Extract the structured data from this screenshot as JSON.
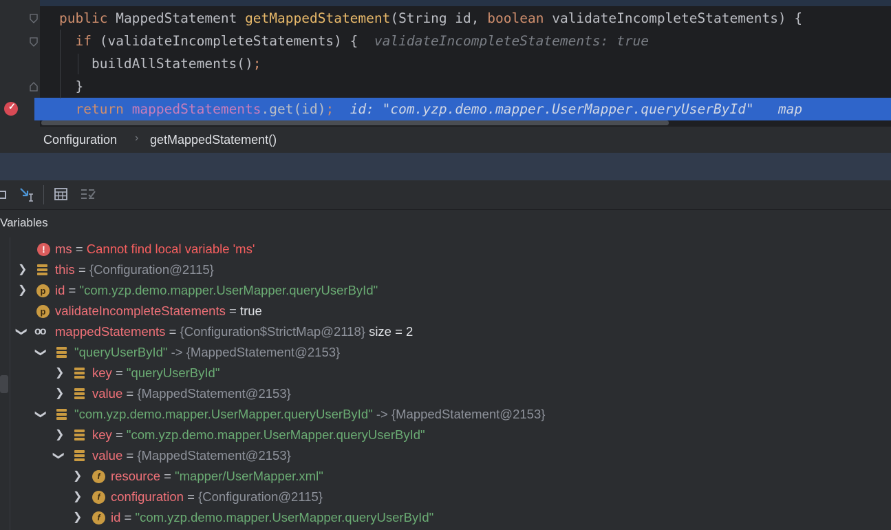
{
  "code": {
    "line1": {
      "kw1": "public",
      "type": "MappedStatement",
      "fn": "getMappedStatement",
      "p1": "(String id, ",
      "kw2": "boolean",
      "p2": " validateIncompleteStatements) {"
    },
    "line2": {
      "kw": "if",
      "rest": " (validateIncompleteStatements) {",
      "hint": "validateIncompleteStatements: true"
    },
    "line3": {
      "call": "buildAllStatements()",
      "semi": ";"
    },
    "line4": {
      "brace": "}"
    },
    "line5": {
      "kw": "return",
      "field": "mappedStatements",
      "call": ".get(id)",
      "semi": ";",
      "hint": "id: \"com.yzp.demo.mapper.UserMapper.queryUserById\"",
      "hint2": "map"
    }
  },
  "breadcrumb": {
    "items": [
      "Configuration",
      "getMappedStatement()"
    ]
  },
  "panel": {
    "title": "Variables"
  },
  "variables": [
    {
      "name": "ms",
      "eq": "=",
      "value": "Cannot find local variable 'ms'",
      "kind": "error"
    },
    {
      "name": "this",
      "eq": "=",
      "value": "{Configuration@2115}"
    },
    {
      "name": "id",
      "eq": "=",
      "value": "\"com.yzp.demo.mapper.UserMapper.queryUserById\""
    },
    {
      "name": "validateIncompleteStatements",
      "eq": "=",
      "value": "true"
    },
    {
      "name": "mappedStatements",
      "eq": "=",
      "value": "{Configuration$StrictMap@2118}",
      "extra": "size = 2"
    },
    {
      "name": "\"queryUserById\"",
      "arrow": "->",
      "value": "{MappedStatement@2153}"
    },
    {
      "name": "key",
      "eq": "=",
      "value": "\"queryUserById\""
    },
    {
      "name": "value",
      "eq": "=",
      "value": "{MappedStatement@2153}"
    },
    {
      "name": "\"com.yzp.demo.mapper.UserMapper.queryUserById\"",
      "arrow": "->",
      "value": "{MappedStatement@2153}"
    },
    {
      "name": "key",
      "eq": "=",
      "value": "\"com.yzp.demo.mapper.UserMapper.queryUserById\""
    },
    {
      "name": "value",
      "eq": "=",
      "value": "{MappedStatement@2153}"
    },
    {
      "name": "resource",
      "eq": "=",
      "value": "\"mapper/UserMapper.xml\""
    },
    {
      "name": "configuration",
      "eq": "=",
      "value": "{Configuration@2115}"
    },
    {
      "name": "id",
      "eq": "=",
      "value": "\"com.yzp.demo.mapper.UserMapper.queryUserById\""
    }
  ],
  "icons": {
    "expand": "chevron-right-icon",
    "collapse": "chevron-down-icon"
  }
}
